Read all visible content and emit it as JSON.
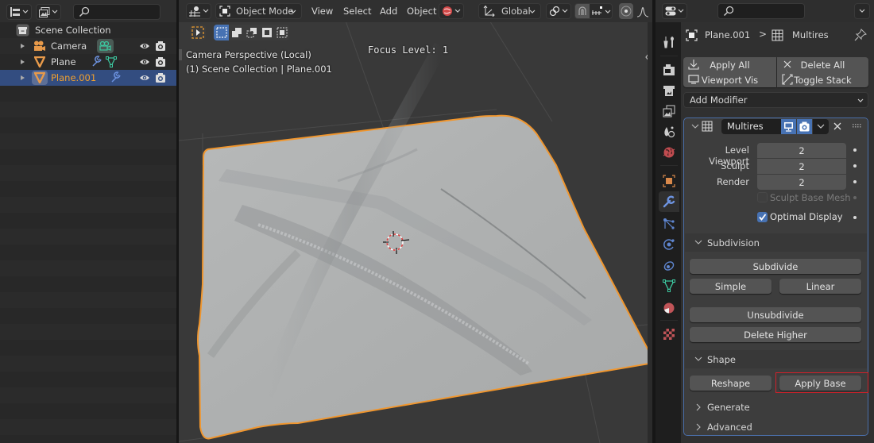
{
  "outliner": {
    "search_placeholder": "",
    "items": [
      {
        "label": "Scene Collection",
        "icon": "collection-icon",
        "visible": true
      },
      {
        "label": "Camera",
        "icon": "camera-object-icon",
        "data_icon": "camera-data-icon",
        "visible": true,
        "renderable": true
      },
      {
        "label": "Plane",
        "icon": "mesh-object-icon",
        "modifier_icon": "wrench-icon",
        "data_icon": "mesh-data-icon",
        "visible": true,
        "renderable": true
      },
      {
        "label": "Plane.001",
        "icon": "mesh-object-icon",
        "modifier_icon": "wrench-icon",
        "visible": true,
        "renderable": true,
        "selected": true
      }
    ]
  },
  "viewport": {
    "mode": "Object Mode",
    "menus": [
      "View",
      "Select",
      "Add",
      "Object"
    ],
    "transform_orientation": "Global",
    "overlay": {
      "camera_label": "Camera Perspective (Local)",
      "collection_label": "(1) Scene Collection | Plane.001",
      "focus_level": "Focus Level: 1"
    }
  },
  "properties": {
    "search_placeholder": "",
    "breadcrumb": {
      "object": "Plane.001",
      "separator": ">",
      "modifier": "Multires"
    },
    "stack_buttons": {
      "apply_all": "Apply All",
      "delete_all": "Delete All",
      "viewport_vis": "Viewport Vis",
      "toggle_stack": "Toggle Stack"
    },
    "add_modifier": "Add Modifier",
    "modifier": {
      "name": "Multires",
      "show_viewport": true,
      "show_render": true,
      "fields": [
        {
          "label": "Level Viewport",
          "value": "2"
        },
        {
          "label": "Sculpt",
          "value": "2"
        },
        {
          "label": "Render",
          "value": "2"
        }
      ],
      "sculpt_base_mesh": {
        "label": "Sculpt Base Mesh",
        "checked": false,
        "enabled": false
      },
      "optimal_display": {
        "label": "Optimal Display",
        "checked": true
      },
      "subdivision": {
        "title": "Subdivision",
        "expanded": true,
        "subdivide": "Subdivide",
        "simple": "Simple",
        "linear": "Linear",
        "unsubdivide": "Unsubdivide",
        "delete_higher": "Delete Higher"
      },
      "shape": {
        "title": "Shape",
        "expanded": true,
        "reshape": "Reshape",
        "apply_base": "Apply Base"
      },
      "generate": {
        "title": "Generate",
        "expanded": false
      },
      "advanced": {
        "title": "Advanced",
        "expanded": false
      }
    },
    "highlight_color": "#d0202a",
    "accent_color": "#4772b3"
  }
}
